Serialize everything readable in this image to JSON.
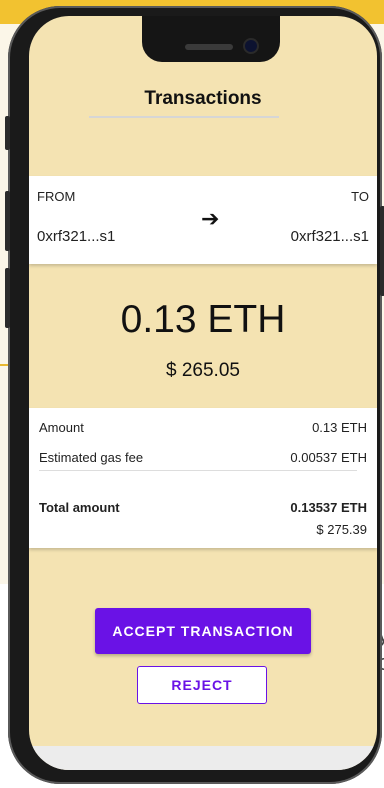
{
  "background": {
    "text_fragment_1": "y",
    "text_fragment_2": "c",
    "colors": {
      "banner": "#f2c230",
      "panel": "#fbf6e8"
    }
  },
  "screen": {
    "title": "Transactions",
    "background_color": "#f4e3b2",
    "transfer": {
      "from_label": "FROM",
      "to_label": "TO",
      "from_address": "0xrf321...s1",
      "to_address": "0xrf321...s1",
      "arrow_icon": "arrow-right-icon",
      "arrow_glyph": "➔"
    },
    "amount_display": "0.13 ETH",
    "usd_display": "$ 265.05",
    "details": {
      "amount_label": "Amount",
      "amount_value": "0.13 ETH",
      "gas_label": "Estimated gas fee",
      "gas_value": "0.00537 ETH",
      "total_label": "Total amount",
      "total_value": "0.13537 ETH",
      "total_usd": "$ 275.39"
    },
    "actions": {
      "accept_label": "ACCEPT TRANSACTION",
      "reject_label": "REJECT",
      "accent_color": "#6a12e6"
    }
  }
}
